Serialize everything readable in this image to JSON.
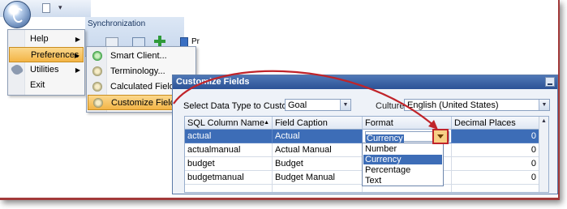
{
  "app": {
    "ribbon_tab": "Synchronization",
    "ribbon_partial": "Pr"
  },
  "app_menu": {
    "items": [
      {
        "label": "Help"
      },
      {
        "label": "Preferences"
      },
      {
        "label": "Utilities"
      },
      {
        "label": "Exit"
      }
    ]
  },
  "preferences_menu": {
    "items": [
      {
        "label": "Smart Client..."
      },
      {
        "label": "Terminology..."
      },
      {
        "label": "Calculated Fields..."
      },
      {
        "label": "Customize Fields..."
      }
    ]
  },
  "dialog": {
    "title": "Customize Fields",
    "data_type_label": "Select Data Type to Customize:",
    "data_type_value": "Goal",
    "culture_label": "Culture:",
    "culture_value": "English (United States)",
    "grid": {
      "columns": [
        "SQL Column Name",
        "Field Caption",
        "Format",
        "Decimal Places"
      ],
      "rows": [
        {
          "sql": "actual",
          "caption": "Actual",
          "format": "Currency",
          "decimals": "0"
        },
        {
          "sql": "actualmanual",
          "caption": "Actual Manual",
          "format": "",
          "decimals": "0"
        },
        {
          "sql": "budget",
          "caption": "Budget",
          "format": "",
          "decimals": "0"
        },
        {
          "sql": "budgetmanual",
          "caption": "Budget Manual",
          "format": "",
          "decimals": "0"
        }
      ]
    },
    "format_options": [
      "Number",
      "Currency",
      "Percentage",
      "Text"
    ],
    "selected_format": "Currency"
  },
  "colors": {
    "highlight": "#c0242a",
    "selection": "#3d6db7",
    "menu_hover": "#f3b446"
  }
}
